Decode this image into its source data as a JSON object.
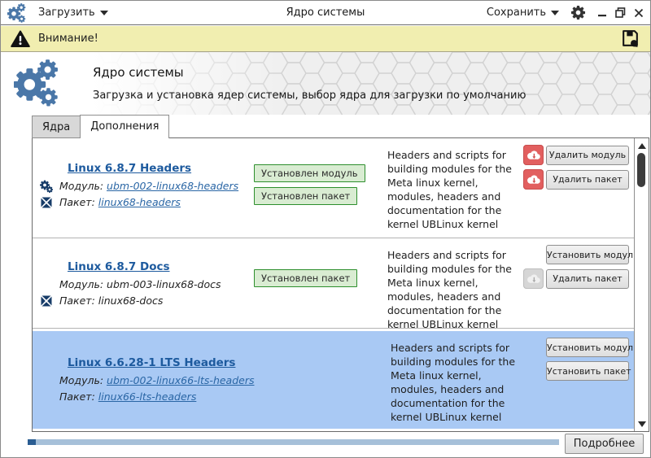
{
  "titlebar": {
    "load_label": "Загрузить",
    "title": "Ядро системы",
    "save_label": "Сохранить"
  },
  "warning": {
    "label": "Внимание!"
  },
  "header": {
    "title": "Ядро системы",
    "subtitle": "Загрузка и установка ядер системы, выбор ядра для загрузки по умолчанию"
  },
  "tabs": [
    {
      "label": "Ядра",
      "active": false
    },
    {
      "label": "Дополнения",
      "active": true
    }
  ],
  "list": {
    "rows": [
      {
        "title": "Linux 6.8.7 Headers",
        "module_label": "Модуль:",
        "module_value": "ubm-002-linux68-headers",
        "module_is_link": true,
        "package_label": "Пакет:",
        "package_value": "linux68-headers",
        "package_is_link": true,
        "badges": [
          "Установлен модуль",
          "Установлен пакет"
        ],
        "description": "Headers and scripts for building modules for the Meta linux kernel, modules, headers and documentation for the kernel UBLinux kernel",
        "actions": [
          {
            "icon": "cloud-remove",
            "icon_color": "red",
            "label": "Удалить модуль"
          },
          {
            "icon": "cloud-remove",
            "icon_color": "red",
            "label": "Удалить пакет"
          }
        ],
        "selected": false
      },
      {
        "title": "Linux 6.8.7 Docs",
        "module_label": "Модуль:",
        "module_value": "ubm-003-linux68-docs",
        "module_is_link": false,
        "package_label": "Пакет:",
        "package_value": "linux68-docs",
        "package_is_link": false,
        "badges": [
          "Установлен пакет"
        ],
        "description": "Headers and scripts for building modules for the Meta linux kernel, modules, headers and documentation for the kernel UBLinux kernel",
        "actions": [
          {
            "icon": null,
            "label": "Установить модуль"
          },
          {
            "icon": "cloud-remove",
            "icon_color": "gray",
            "label": "Удалить пакет"
          }
        ],
        "selected": false
      },
      {
        "title": "Linux 6.6.28-1 LTS Headers",
        "module_label": "Модуль:",
        "module_value": "ubm-002-linux66-lts-headers",
        "module_is_link": true,
        "package_label": "Пакет:",
        "package_value": "linux66-lts-headers",
        "package_is_link": true,
        "badges": [],
        "description": "Headers and scripts for building modules for the Meta linux kernel, modules, headers and documentation for the kernel UBLinux kernel",
        "actions": [
          {
            "icon": null,
            "label": "Установить модуль"
          },
          {
            "icon": null,
            "label": "Установить пакет"
          }
        ],
        "selected": true
      }
    ]
  },
  "footer": {
    "details_label": "Подробнее",
    "progress_percent": 1.5
  },
  "colors": {
    "accent_blue": "#4a77a8",
    "link_blue": "#1d5a9e",
    "selected_row": "#a9c9f4",
    "warning_bg": "#f1eeb0",
    "badge_border": "#2d8f2d",
    "badge_bg": "#d9ecd2",
    "danger_red": "#e25f5f",
    "progress_track": "#a6c0d9",
    "progress_fill": "#2a5d92"
  }
}
